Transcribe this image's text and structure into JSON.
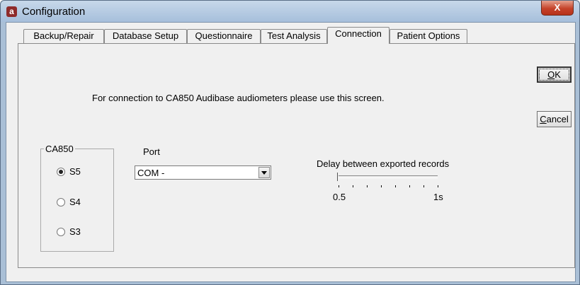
{
  "window": {
    "title": "Configuration",
    "app_icon_letter": "a",
    "close_glyph": "X"
  },
  "tabs": [
    {
      "label": "Backup/Repair",
      "active": false
    },
    {
      "label": "Database Setup",
      "active": false
    },
    {
      "label": "Questionnaire",
      "active": false
    },
    {
      "label": "Test Analysis",
      "active": false
    },
    {
      "label": "Connection",
      "active": true
    },
    {
      "label": "Patient Options",
      "active": false
    }
  ],
  "buttons": {
    "ok_accel": "O",
    "ok_rest": "K",
    "cancel_accel": "C",
    "cancel_rest": "ancel"
  },
  "connection": {
    "info_text": "For connection to CA850 Audibase audiometers please use this screen.",
    "group_label": "CA850",
    "radios": [
      {
        "label": "S5",
        "checked": true
      },
      {
        "label": "S4",
        "checked": false
      },
      {
        "label": "S3",
        "checked": false
      }
    ],
    "port_label": "Port",
    "port_value": "COM -",
    "delay_label": "Delay between exported records",
    "delay_min_label": "0.5",
    "delay_max_label": "1s",
    "delay_value_fraction": 0.0
  },
  "colors": {
    "frame": "#a9bfd6",
    "close": "#c5432a",
    "app_icon": "#8e2b2b"
  }
}
